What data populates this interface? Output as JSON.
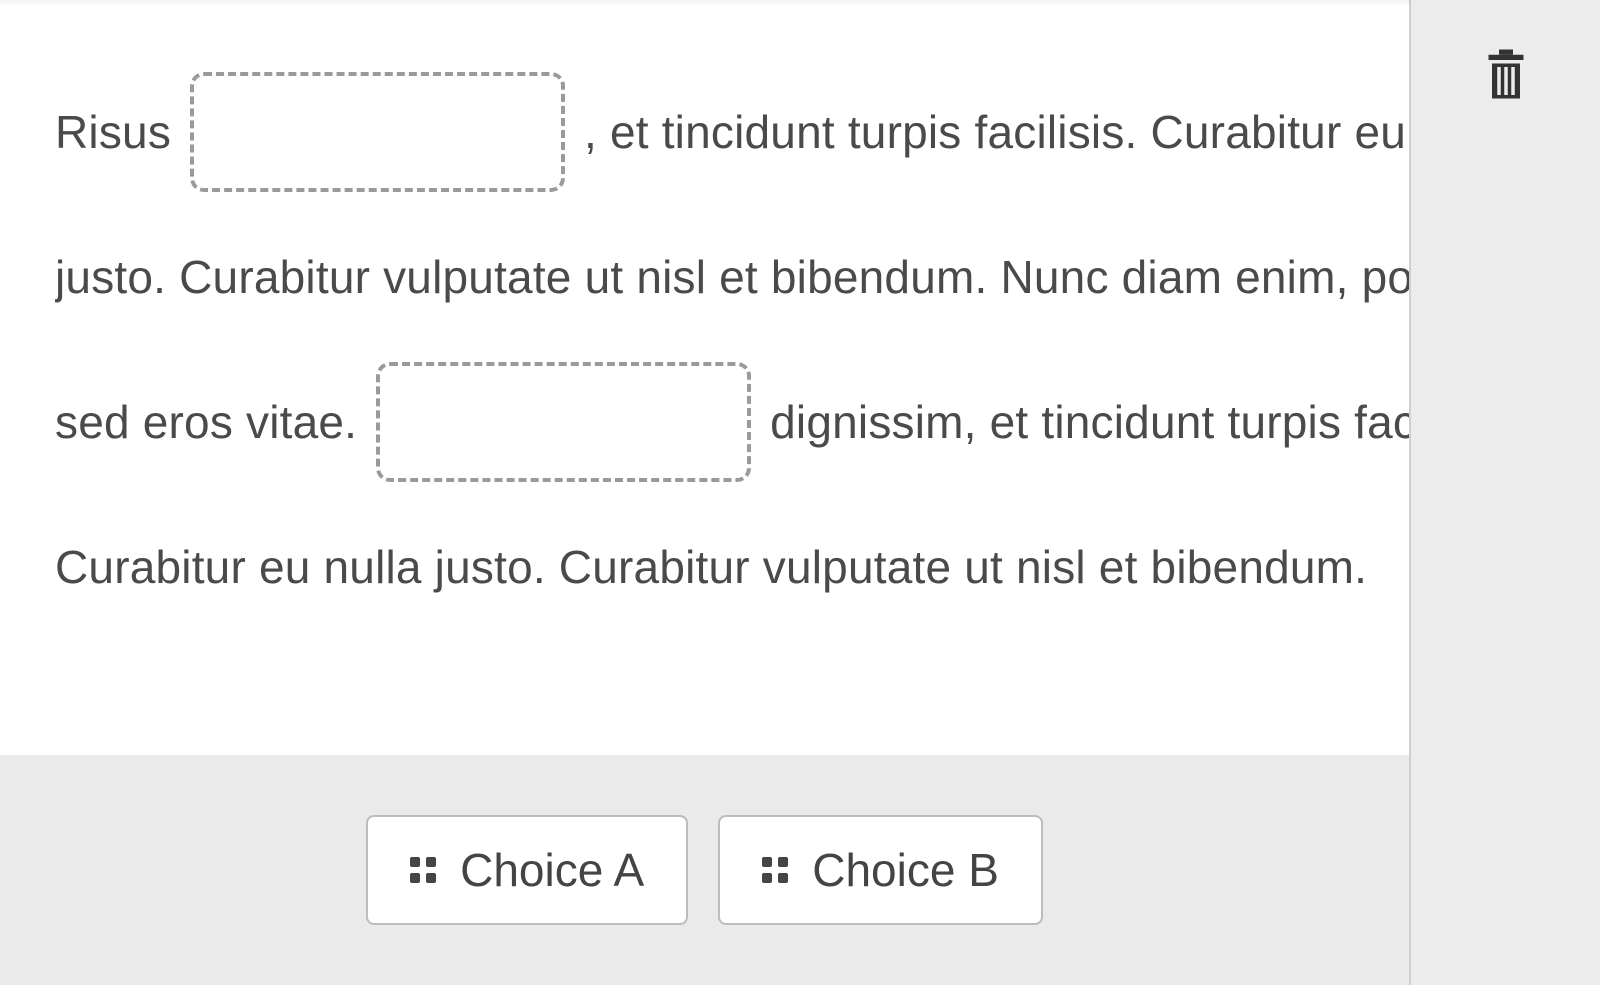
{
  "content": {
    "line1_before": "Risus ",
    "line1_after": ", et tincidunt turpis facilisis. Curabitur eu nulla",
    "line2": "justo. Curabitur vulputate ut nisl et bibendum. Nunc diam enim, porta",
    "line3_before": "sed eros vitae. ",
    "line3_after": " dignissim, et tincidunt turpis facilisis.",
    "line4": "Curabitur eu nulla justo. Curabitur vulputate ut nisl et bibendum."
  },
  "choices": {
    "a": "Choice A",
    "b": "Choice B"
  }
}
